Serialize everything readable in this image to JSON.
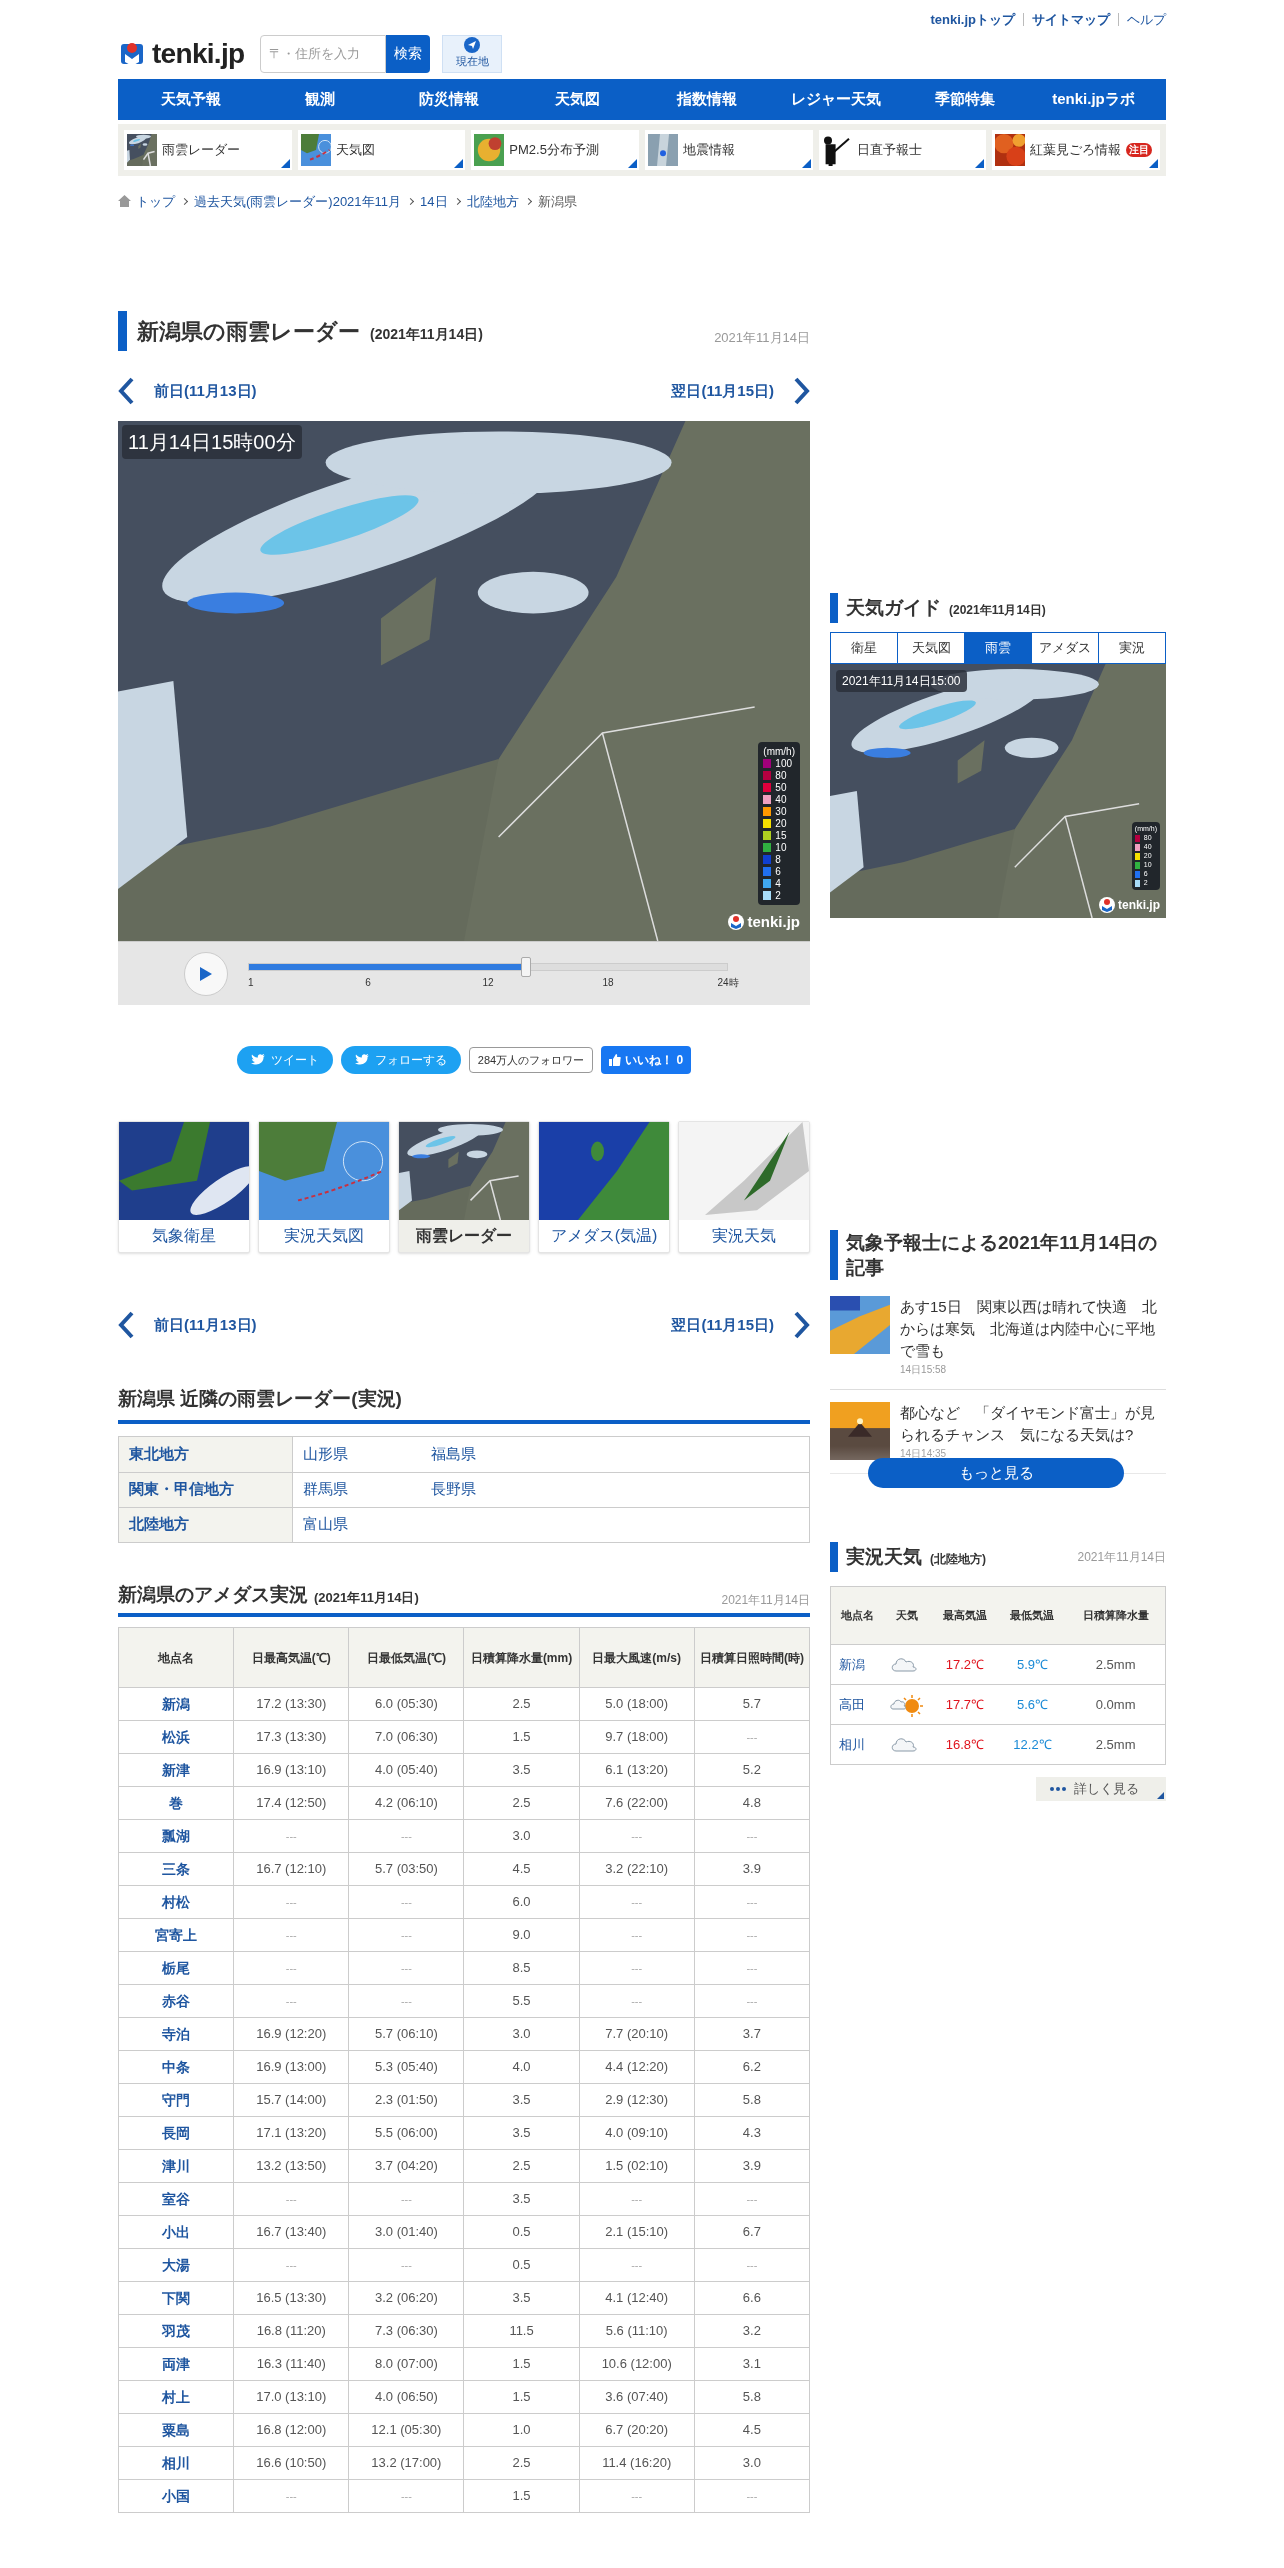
{
  "top_links": [
    {
      "label": "tenki.jpトップ",
      "bold": true
    },
    {
      "label": "サイトマップ",
      "bold": true
    },
    {
      "label": "ヘルプ",
      "bold": false
    }
  ],
  "logo": {
    "text": "tenki.jp"
  },
  "search": {
    "placeholder": "〒・住所を入力",
    "button": "検索"
  },
  "location_button": "現在地",
  "nav": [
    "天気予報",
    "観測",
    "防災情報",
    "天気図",
    "指数情報",
    "レジャー天気",
    "季節特集",
    "tenki.jpラボ"
  ],
  "sub_nav": [
    {
      "label": "雨雲レーダー",
      "kind": "radar"
    },
    {
      "label": "天気図",
      "kind": "chart"
    },
    {
      "label": "PM2.5分布予測",
      "kind": "pm"
    },
    {
      "label": "地震情報",
      "kind": "quake"
    },
    {
      "label": "日直予報士",
      "kind": "person"
    },
    {
      "label": "紅葉見ごろ情報",
      "kind": "leaves",
      "badge": "注目"
    }
  ],
  "breadcrumb": [
    {
      "label": "トップ",
      "link": true
    },
    {
      "label": "過去天気(雨雲レーダー)2021年11月",
      "link": true
    },
    {
      "label": "14日",
      "link": true
    },
    {
      "label": "北陸地方",
      "link": true
    },
    {
      "label": "新潟県",
      "link": false
    }
  ],
  "page_title": {
    "title": "新潟県の雨雲レーダー",
    "suffix": "(2021年11月14日)",
    "date": "2021年11月14日"
  },
  "day_nav_top": {
    "prev": "前日(11月13日)",
    "next": "翌日(11月15日)"
  },
  "radar": {
    "timestamp": "11月14日15時00分",
    "legend_unit": "(mm/h)",
    "brand": "tenki.jp",
    "legend": [
      {
        "label": "100",
        "color": "#a0007a"
      },
      {
        "label": "80",
        "color": "#b40040"
      },
      {
        "label": "50",
        "color": "#e0003c"
      },
      {
        "label": "40",
        "color": "#f0a0c0"
      },
      {
        "label": "30",
        "color": "#ff9900"
      },
      {
        "label": "20",
        "color": "#f5e000"
      },
      {
        "label": "15",
        "color": "#b0d020"
      },
      {
        "label": "10",
        "color": "#30b040"
      },
      {
        "label": "8",
        "color": "#1040d0"
      },
      {
        "label": "6",
        "color": "#2070f0"
      },
      {
        "label": "4",
        "color": "#40a8f0"
      },
      {
        "label": "2",
        "color": "#a8dcf8"
      }
    ],
    "slider": {
      "level": 0.58,
      "ticks": [
        "1",
        "6",
        "12",
        "18",
        "24時"
      ]
    }
  },
  "social": {
    "tweet": "ツイート",
    "follow": "フォローする",
    "followers": "284万人のフォロワー",
    "like": "いいね！ 0"
  },
  "thumbnails": [
    {
      "label": "気象衛星",
      "kind": "satellite",
      "selected": false
    },
    {
      "label": "実況天気図",
      "kind": "chart",
      "selected": false
    },
    {
      "label": "雨雲レーダー",
      "kind": "radar",
      "selected": true
    },
    {
      "label": "アメダス(気温)",
      "kind": "amedas",
      "selected": false
    },
    {
      "label": "実況天気",
      "kind": "weather",
      "selected": false
    }
  ],
  "day_nav_bottom": {
    "prev": "前日(11月13日)",
    "next": "翌日(11月15日)"
  },
  "nearby": {
    "title": "新潟県 近隣の雨雲レーダー(実況)",
    "rows": [
      {
        "region": "東北地方",
        "prefs": [
          "山形県",
          "福島県"
        ]
      },
      {
        "region": "関東・甲信地方",
        "prefs": [
          "群馬県",
          "長野県"
        ]
      },
      {
        "region": "北陸地方",
        "prefs": [
          "富山県"
        ]
      }
    ]
  },
  "amedas": {
    "title": "新潟県のアメダス実況",
    "suffix": "(2021年11月14日)",
    "date": "2021年11月14日",
    "columns": [
      "地点名",
      "日最高気温(℃)",
      "日最低気温(℃)",
      "日積算降水量(mm)",
      "日最大風速(m/s)",
      "日積算日照時間(時)"
    ],
    "rows": [
      [
        "新潟",
        "17.2 (13:30)",
        "6.0 (05:30)",
        "2.5",
        "5.0 (18:00)",
        "5.7"
      ],
      [
        "松浜",
        "17.3 (13:30)",
        "7.0 (06:30)",
        "1.5",
        "9.7 (18:00)",
        "---"
      ],
      [
        "新津",
        "16.9 (13:10)",
        "4.0 (05:40)",
        "3.5",
        "6.1 (13:20)",
        "5.2"
      ],
      [
        "巻",
        "17.4 (12:50)",
        "4.2 (06:10)",
        "2.5",
        "7.6 (22:00)",
        "4.8"
      ],
      [
        "瓢湖",
        "---",
        "---",
        "3.0",
        "---",
        "---"
      ],
      [
        "三条",
        "16.7 (12:10)",
        "5.7 (03:50)",
        "4.5",
        "3.2 (22:10)",
        "3.9"
      ],
      [
        "村松",
        "---",
        "---",
        "6.0",
        "---",
        "---"
      ],
      [
        "宮寄上",
        "---",
        "---",
        "9.0",
        "---",
        "---"
      ],
      [
        "栃尾",
        "---",
        "---",
        "8.5",
        "---",
        "---"
      ],
      [
        "赤谷",
        "---",
        "---",
        "5.5",
        "---",
        "---"
      ],
      [
        "寺泊",
        "16.9 (12:20)",
        "5.7 (06:10)",
        "3.0",
        "7.7 (20:10)",
        "3.7"
      ],
      [
        "中条",
        "16.9 (13:00)",
        "5.3 (05:40)",
        "4.0",
        "4.4 (12:20)",
        "6.2"
      ],
      [
        "守門",
        "15.7 (14:00)",
        "2.3 (01:50)",
        "3.5",
        "2.9 (12:30)",
        "5.8"
      ],
      [
        "長岡",
        "17.1 (13:20)",
        "5.5 (06:00)",
        "3.5",
        "4.0 (09:10)",
        "4.3"
      ],
      [
        "津川",
        "13.2 (13:50)",
        "3.7 (04:20)",
        "2.5",
        "1.5 (02:10)",
        "3.9"
      ],
      [
        "室谷",
        "---",
        "---",
        "3.5",
        "---",
        "---"
      ],
      [
        "小出",
        "16.7 (13:40)",
        "3.0 (01:40)",
        "0.5",
        "2.1 (15:10)",
        "6.7"
      ],
      [
        "大湯",
        "---",
        "---",
        "0.5",
        "---",
        "---"
      ],
      [
        "下関",
        "16.5 (13:30)",
        "3.2 (06:20)",
        "3.5",
        "4.1 (12:40)",
        "6.6"
      ],
      [
        "羽茂",
        "16.8 (11:20)",
        "7.3 (06:30)",
        "11.5",
        "5.6 (11:10)",
        "3.2"
      ],
      [
        "両津",
        "16.3 (11:40)",
        "8.0 (07:00)",
        "1.5",
        "10.6 (12:00)",
        "3.1"
      ],
      [
        "村上",
        "17.0 (13:10)",
        "4.0 (06:50)",
        "1.5",
        "3.6 (07:40)",
        "5.8"
      ],
      [
        "粟島",
        "16.8 (12:00)",
        "12.1 (05:30)",
        "1.0",
        "6.7 (20:20)",
        "4.5"
      ],
      [
        "相川",
        "16.6 (10:50)",
        "13.2 (17:00)",
        "2.5",
        "11.4 (16:20)",
        "3.0"
      ],
      [
        "小国",
        "---",
        "---",
        "1.5",
        "---",
        "---"
      ]
    ]
  },
  "guide": {
    "title": "天気ガイド",
    "suffix": "(2021年11月14日)",
    "tabs": [
      {
        "label": "衛星",
        "selected": false
      },
      {
        "label": "天気図",
        "selected": false
      },
      {
        "label": "雨雲",
        "selected": true
      },
      {
        "label": "アメダス",
        "selected": false
      },
      {
        "label": "実況",
        "selected": false
      }
    ],
    "timestamp": "2021年11月14日15:00",
    "legend_unit": "(mm/h)",
    "brand": "tenki.jp",
    "legend": [
      {
        "label": "80",
        "color": "#b40040"
      },
      {
        "label": "40",
        "color": "#f0a0c0"
      },
      {
        "label": "20",
        "color": "#f5e000"
      },
      {
        "label": "10",
        "color": "#30b040"
      },
      {
        "label": "6",
        "color": "#2070f0"
      },
      {
        "label": "2",
        "color": "#a8dcf8"
      }
    ]
  },
  "articles": {
    "title": "気象予報士による2021年11月14日の記事",
    "items": [
      {
        "title": "あす15日　関東以西は晴れて快適　北からは寒気　北海道は内陸中心に平地で雪も",
        "time": "14日15:58",
        "kind": "map"
      },
      {
        "title": "都心など　「ダイヤモンド富士」が見られるチャンス　気になる天気は?",
        "time": "14日14:35",
        "kind": "sunset"
      }
    ],
    "more": "もっと見る"
  },
  "current": {
    "title": "実況天気",
    "suffix": "(北陸地方)",
    "date": "2021年11月14日",
    "columns": [
      "地点名",
      "天気",
      "最高気温",
      "最低気温",
      "日積算降水量"
    ],
    "rows": [
      {
        "name": "新潟",
        "kind": "cloudy",
        "high": "17.2℃",
        "low": "5.9℃",
        "precip": "2.5mm"
      },
      {
        "name": "高田",
        "kind": "sun_cloud",
        "high": "17.7℃",
        "low": "5.6℃",
        "precip": "0.0mm"
      },
      {
        "name": "相川",
        "kind": "cloudy",
        "high": "16.8℃",
        "low": "12.2℃",
        "precip": "2.5mm"
      }
    ],
    "more": "詳しく見る"
  }
}
